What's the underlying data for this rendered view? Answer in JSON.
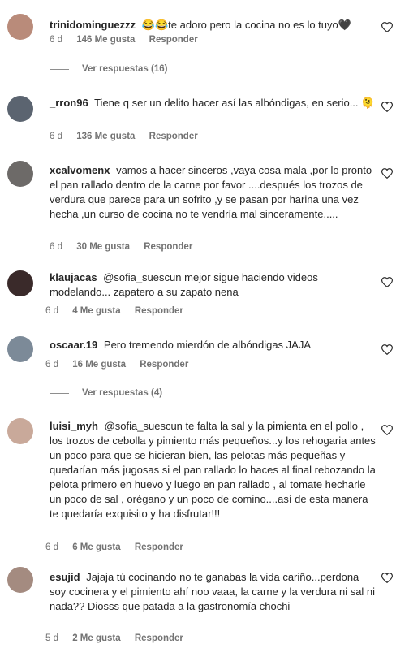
{
  "comments": [
    {
      "user": "trinidominguezzz",
      "text": "😂😂te adoro pero la cocina no es lo tuyo🖤",
      "time": "6 d",
      "likes": "146 Me gusta",
      "reply": "Responder",
      "avatar_color": "#b98b7a"
    },
    {
      "user": "_rron96",
      "text": "Tiene q ser un delito hacer así las albóndigas, en serio... 🫠",
      "time": "6 d",
      "likes": "136 Me gusta",
      "reply": "Responder",
      "avatar_color": "#5b6470"
    },
    {
      "user": "xcalvomenx",
      "text": "vamos a hacer sinceros ,vaya cosa mala ,por lo pronto el pan rallado dentro de la carne por favor ....después los trozos de verdura que parece para un sofrito ,y se pasan por harina una vez hecha ,un curso de cocina no te vendría mal sinceramente.....",
      "time": "6 d",
      "likes": "30 Me gusta",
      "reply": "Responder",
      "avatar_color": "#6d6a68"
    },
    {
      "user": "klaujacas",
      "mention": "@sofia_suescun",
      "text": "mejor sigue haciendo videos modelando... zapatero a su zapato nena",
      "time": "6 d",
      "likes": "4 Me gusta",
      "reply": "Responder",
      "avatar_color": "#3a2a2a"
    },
    {
      "user": "oscaar.19",
      "text": "Pero tremendo mierdón de albóndigas JAJA",
      "time": "6 d",
      "likes": "16 Me gusta",
      "reply": "Responder",
      "avatar_color": "#7c8a98"
    },
    {
      "user": "luisi_myh",
      "mention": "@sofia_suescun",
      "text": "te falta la sal y la pimienta en el pollo , los trozos de cebolla y pimiento más pequeños...y los rehogaria antes un poco para que se hicieran bien, las pelotas más pequeñas y quedarían más jugosas si el pan rallado lo haces al final rebozando la pelota primero en huevo y luego en pan rallado , al tomate hecharle un poco de sal , orégano y un poco de comino....así de esta manera te quedaría exquisito y ha disfrutar!!!",
      "time": "6 d",
      "likes": "6 Me gusta",
      "reply": "Responder",
      "avatar_color": "#c9a99a"
    },
    {
      "user": "esujid",
      "text": "Jajaja tú cocinando no te ganabas la vida cariño...perdona soy cocinera y el pimiento ahí noo vaaa, la carne y la verdura ni sal ni nada?? Diosss que patada a la gastronomía chochi",
      "time": "5 d",
      "likes": "2 Me gusta",
      "reply": "Responder",
      "avatar_color": "#a48b80"
    }
  ],
  "view_replies": [
    "Ver respuestas (16)",
    "Ver respuestas (4)"
  ]
}
